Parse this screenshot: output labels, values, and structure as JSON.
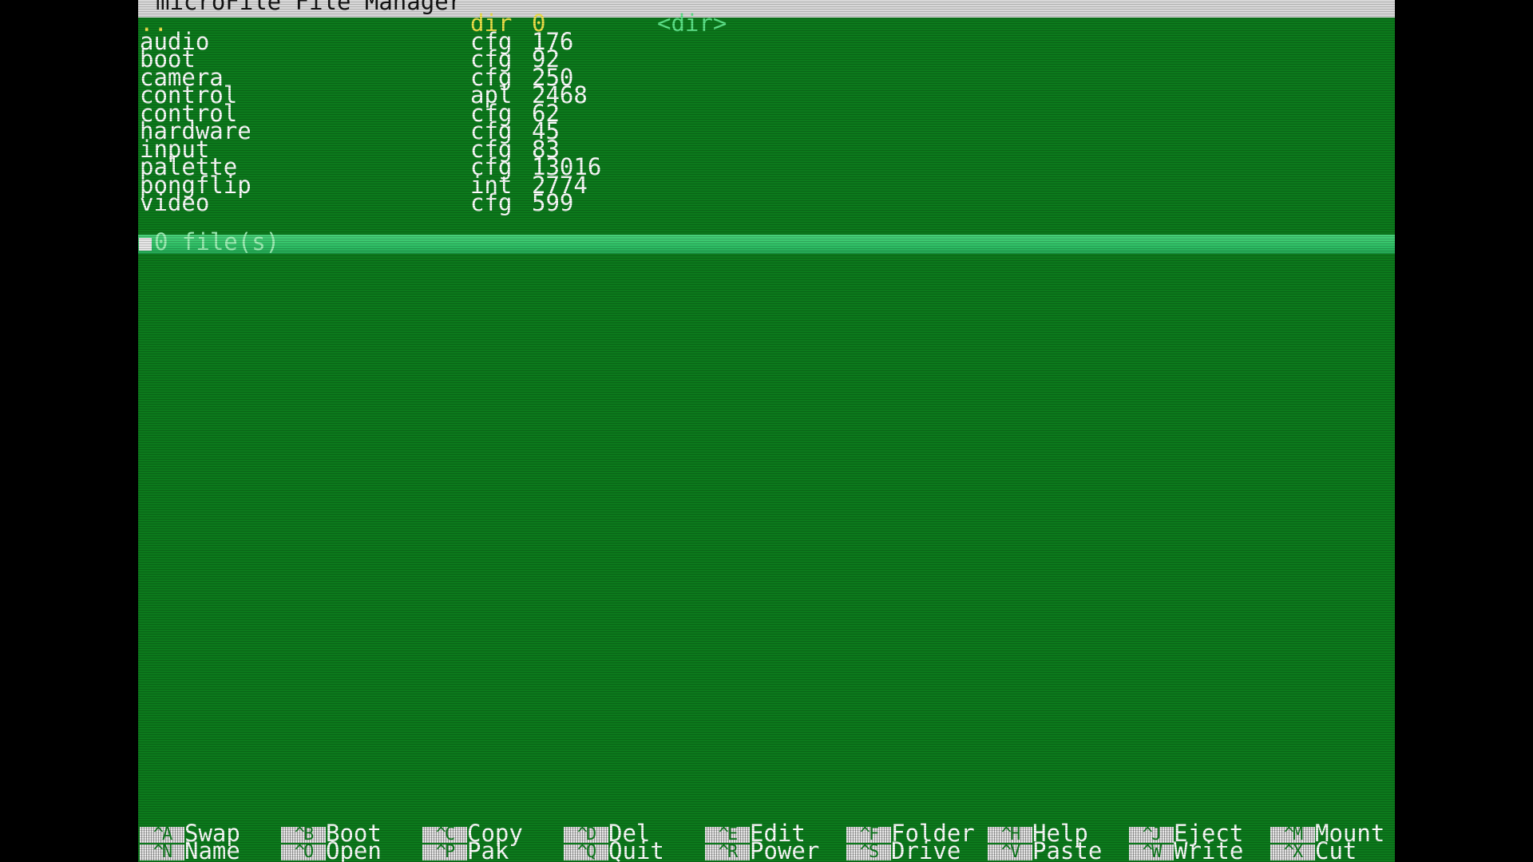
{
  "app": {
    "title": "microFile File Manager"
  },
  "files": [
    {
      "name": "..",
      "type": "dir",
      "size": "0",
      "tag": "<dir>",
      "parent": true
    },
    {
      "name": "audio",
      "type": "cfg",
      "size": "176",
      "tag": ""
    },
    {
      "name": "boot",
      "type": "cfg",
      "size": "92",
      "tag": ""
    },
    {
      "name": "camera",
      "type": "cfg",
      "size": "250",
      "tag": ""
    },
    {
      "name": "control",
      "type": "apl",
      "size": "2468",
      "tag": ""
    },
    {
      "name": "control",
      "type": "cfg",
      "size": "62",
      "tag": ""
    },
    {
      "name": "hardware",
      "type": "cfg",
      "size": "45",
      "tag": ""
    },
    {
      "name": "input",
      "type": "cfg",
      "size": "83",
      "tag": ""
    },
    {
      "name": "palette",
      "type": "cfg",
      "size": "13016",
      "tag": ""
    },
    {
      "name": "pongflip",
      "type": "int",
      "size": "2774",
      "tag": ""
    },
    {
      "name": "video",
      "type": "cfg",
      "size": "599",
      "tag": ""
    }
  ],
  "status": {
    "text": "0 file(s)"
  },
  "function_keys": [
    {
      "top_key": "^A",
      "top_label": "Swap",
      "bottom_key": "^N",
      "bottom_label": "Name"
    },
    {
      "top_key": "^B",
      "top_label": "Boot",
      "bottom_key": "^O",
      "bottom_label": "Open"
    },
    {
      "top_key": "^C",
      "top_label": "Copy",
      "bottom_key": "^P",
      "bottom_label": "Pak"
    },
    {
      "top_key": "^D",
      "top_label": "Del",
      "bottom_key": "^Q",
      "bottom_label": "Quit"
    },
    {
      "top_key": "^E",
      "top_label": "Edit",
      "bottom_key": "^R",
      "bottom_label": "Power"
    },
    {
      "top_key": "^F",
      "top_label": "Folder",
      "bottom_key": "^S",
      "bottom_label": "Drive"
    },
    {
      "top_key": "^H",
      "top_label": "Help",
      "bottom_key": "^V",
      "bottom_label": "Paste"
    },
    {
      "top_key": "^J",
      "top_label": "Eject",
      "bottom_key": "^W",
      "bottom_label": "Write"
    },
    {
      "top_key": "^M",
      "top_label": "Mount",
      "bottom_key": "^X",
      "bottom_label": "Cut"
    }
  ],
  "colors": {
    "background": "#0c7a1c",
    "title_bar": "#d8d8d8",
    "status_bar": "#2fc066",
    "parent_dir_text": "#f0e24a",
    "dir_tag_text": "#5ee58a",
    "letterbox": "#000000"
  }
}
